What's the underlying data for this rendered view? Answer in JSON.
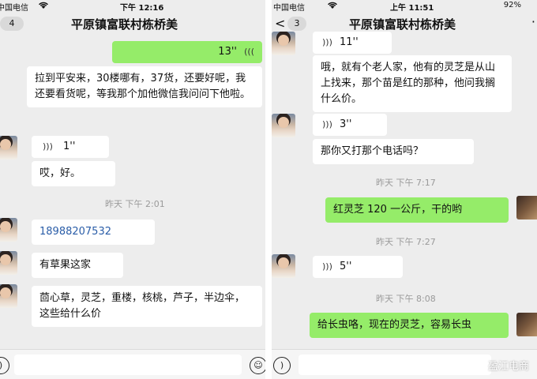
{
  "left_screen": {
    "status": {
      "carrier": "中国电信",
      "time": "下午 12:16"
    },
    "nav": {
      "back_count": "4",
      "title": "平原镇富联村栋桥美"
    },
    "messages": {
      "m1_voice_length": "13''",
      "m2_text": "拉到平安来，30楼哪有，37货，还要好呢，我还要看货呢，等我那个加他微信我问问下他啦。",
      "m3_voice_length": "1''",
      "m4_text": "哎，好。",
      "ts1": "昨天 下午 2:01",
      "m5_text": "18988207532",
      "m6_text": "有草果这家",
      "m7_text": "茴心草，灵芝，重楼，核桃，芦子，半边伞，这些给什么价"
    }
  },
  "right_screen": {
    "status": {
      "carrier": "中国电信",
      "time": "上午 11:51",
      "battery": "92%"
    },
    "nav": {
      "back_count": "3",
      "title": "平原镇富联村栋桥美"
    },
    "messages": {
      "m1_voice_length": "11''",
      "m2_text": "哦，就有个老人家，他有的灵芝是从山上找来，那个苗是红的那种，他问我搁什么价。",
      "m3_voice_length": "3''",
      "m4_text": "那你又打那个电话吗？",
      "ts1": "昨天 下午 7:17",
      "m5_text": "红灵芝 120 一公斤，干的哟",
      "ts2": "昨天 下午 7:27",
      "m6_voice_length": "5''",
      "ts3": "昨天 下午 8:08",
      "m7_text": "给长虫咯，现在的灵芝，容易长虫"
    }
  },
  "watermark": {
    "text": "盈江电商"
  },
  "icons": {
    "wifi": "wifi-icon",
    "battery": "battery-icon",
    "voice": "voice-wave-icon",
    "back": "back-arrow-icon",
    "more": "more-icon",
    "emoji": "emoji-icon",
    "voice_input": "voice-input-icon"
  }
}
